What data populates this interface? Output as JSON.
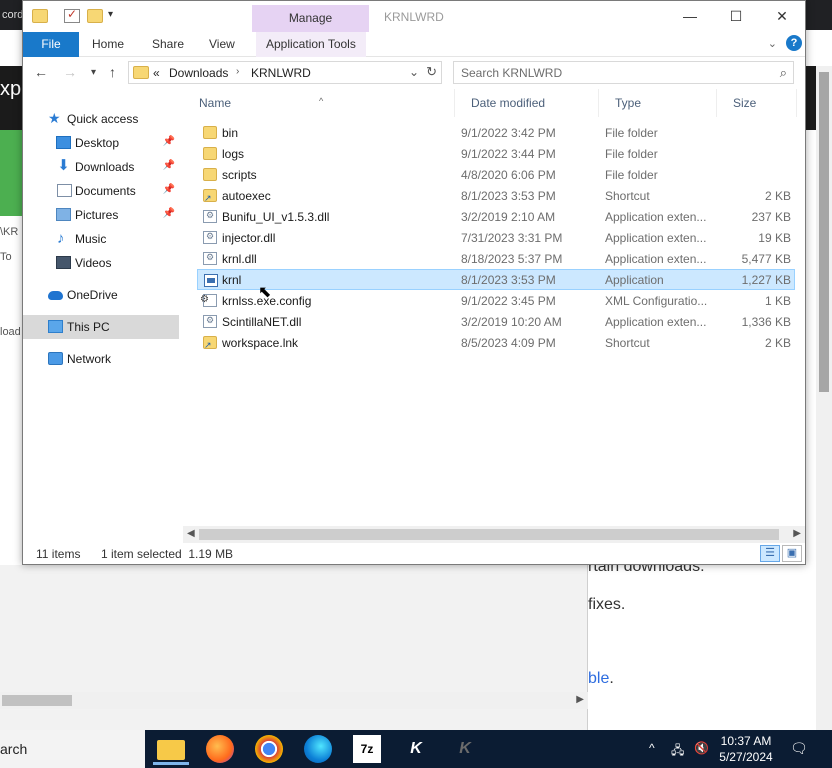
{
  "background": {
    "tab_fragment": "corda",
    "heading_fragment": "xpl",
    "left_fragments": [
      "\\KR",
      "To",
      "load"
    ],
    "content_lines": [
      "rtain downloads.",
      "fixes."
    ],
    "link_fragment": "ble",
    "link_tail": ".",
    "link_color": "#2d6cdf"
  },
  "window": {
    "title": "KRNLWRD",
    "manage_label": "Manage",
    "controls": {
      "minimize": "—",
      "maximize": "☐",
      "close": "✕"
    },
    "ribbon_tabs": [
      "File",
      "Home",
      "Share",
      "View",
      "Application Tools"
    ],
    "accent": "#1979ca",
    "manage_color": "#e6d3f3"
  },
  "address": {
    "overflow": "«",
    "crumbs": [
      "Downloads",
      "KRNLWRD"
    ],
    "search_placeholder": "Search KRNLWRD"
  },
  "sidebar": {
    "items": [
      {
        "label": "Quick access",
        "icon": "star-icon",
        "pinned": false
      },
      {
        "label": "Desktop",
        "icon": "desktop-icon",
        "pinned": true
      },
      {
        "label": "Downloads",
        "icon": "download-icon",
        "pinned": true
      },
      {
        "label": "Documents",
        "icon": "documents-icon",
        "pinned": true
      },
      {
        "label": "Pictures",
        "icon": "pictures-icon",
        "pinned": true
      },
      {
        "label": "Music",
        "icon": "music-icon",
        "pinned": false
      },
      {
        "label": "Videos",
        "icon": "videos-icon",
        "pinned": false
      },
      {
        "label": "OneDrive",
        "icon": "cloud-icon",
        "pinned": false
      },
      {
        "label": "This PC",
        "icon": "computer-icon",
        "pinned": false,
        "selected": true
      },
      {
        "label": "Network",
        "icon": "network-icon",
        "pinned": false
      }
    ]
  },
  "columns": [
    "Name",
    "Date modified",
    "Type",
    "Size"
  ],
  "files": [
    {
      "name": "bin",
      "date": "9/1/2022 3:42 PM",
      "type": "File folder",
      "size": "",
      "icon": "folder-icon"
    },
    {
      "name": "logs",
      "date": "9/1/2022 3:44 PM",
      "type": "File folder",
      "size": "",
      "icon": "folder-icon"
    },
    {
      "name": "scripts",
      "date": "4/8/2020 6:06 PM",
      "type": "File folder",
      "size": "",
      "icon": "folder-icon"
    },
    {
      "name": "autoexec",
      "date": "8/1/2023 3:53 PM",
      "type": "Shortcut",
      "size": "2 KB",
      "icon": "shortcut-icon"
    },
    {
      "name": "Bunifu_UI_v1.5.3.dll",
      "date": "3/2/2019 2:10 AM",
      "type": "Application exten...",
      "size": "237 KB",
      "icon": "dll-icon"
    },
    {
      "name": "injector.dll",
      "date": "7/31/2023 3:31 PM",
      "type": "Application exten...",
      "size": "19 KB",
      "icon": "dll-icon"
    },
    {
      "name": "krnl.dll",
      "date": "8/18/2023 5:37 PM",
      "type": "Application exten...",
      "size": "5,477 KB",
      "icon": "dll-icon"
    },
    {
      "name": "krnl",
      "date": "8/1/2023 3:53 PM",
      "type": "Application",
      "size": "1,227 KB",
      "icon": "application-icon",
      "selected": true
    },
    {
      "name": "krnlss.exe.config",
      "date": "9/1/2022 3:45 PM",
      "type": "XML Configuratio...",
      "size": "1 KB",
      "icon": "config-icon"
    },
    {
      "name": "ScintillaNET.dll",
      "date": "3/2/2019 10:20 AM",
      "type": "Application exten...",
      "size": "1,336 KB",
      "icon": "dll-icon"
    },
    {
      "name": "workspace.lnk",
      "date": "8/5/2023 4:09 PM",
      "type": "Shortcut",
      "size": "2 KB",
      "icon": "shortcut-icon"
    }
  ],
  "status": {
    "count": "11 items",
    "selection": "1 item selected  1.19 MB"
  },
  "taskbar": {
    "search_fragment": "arch",
    "apps": [
      "7z",
      "K",
      "K"
    ],
    "time": "10:37 AM",
    "date": "5/27/2024"
  }
}
